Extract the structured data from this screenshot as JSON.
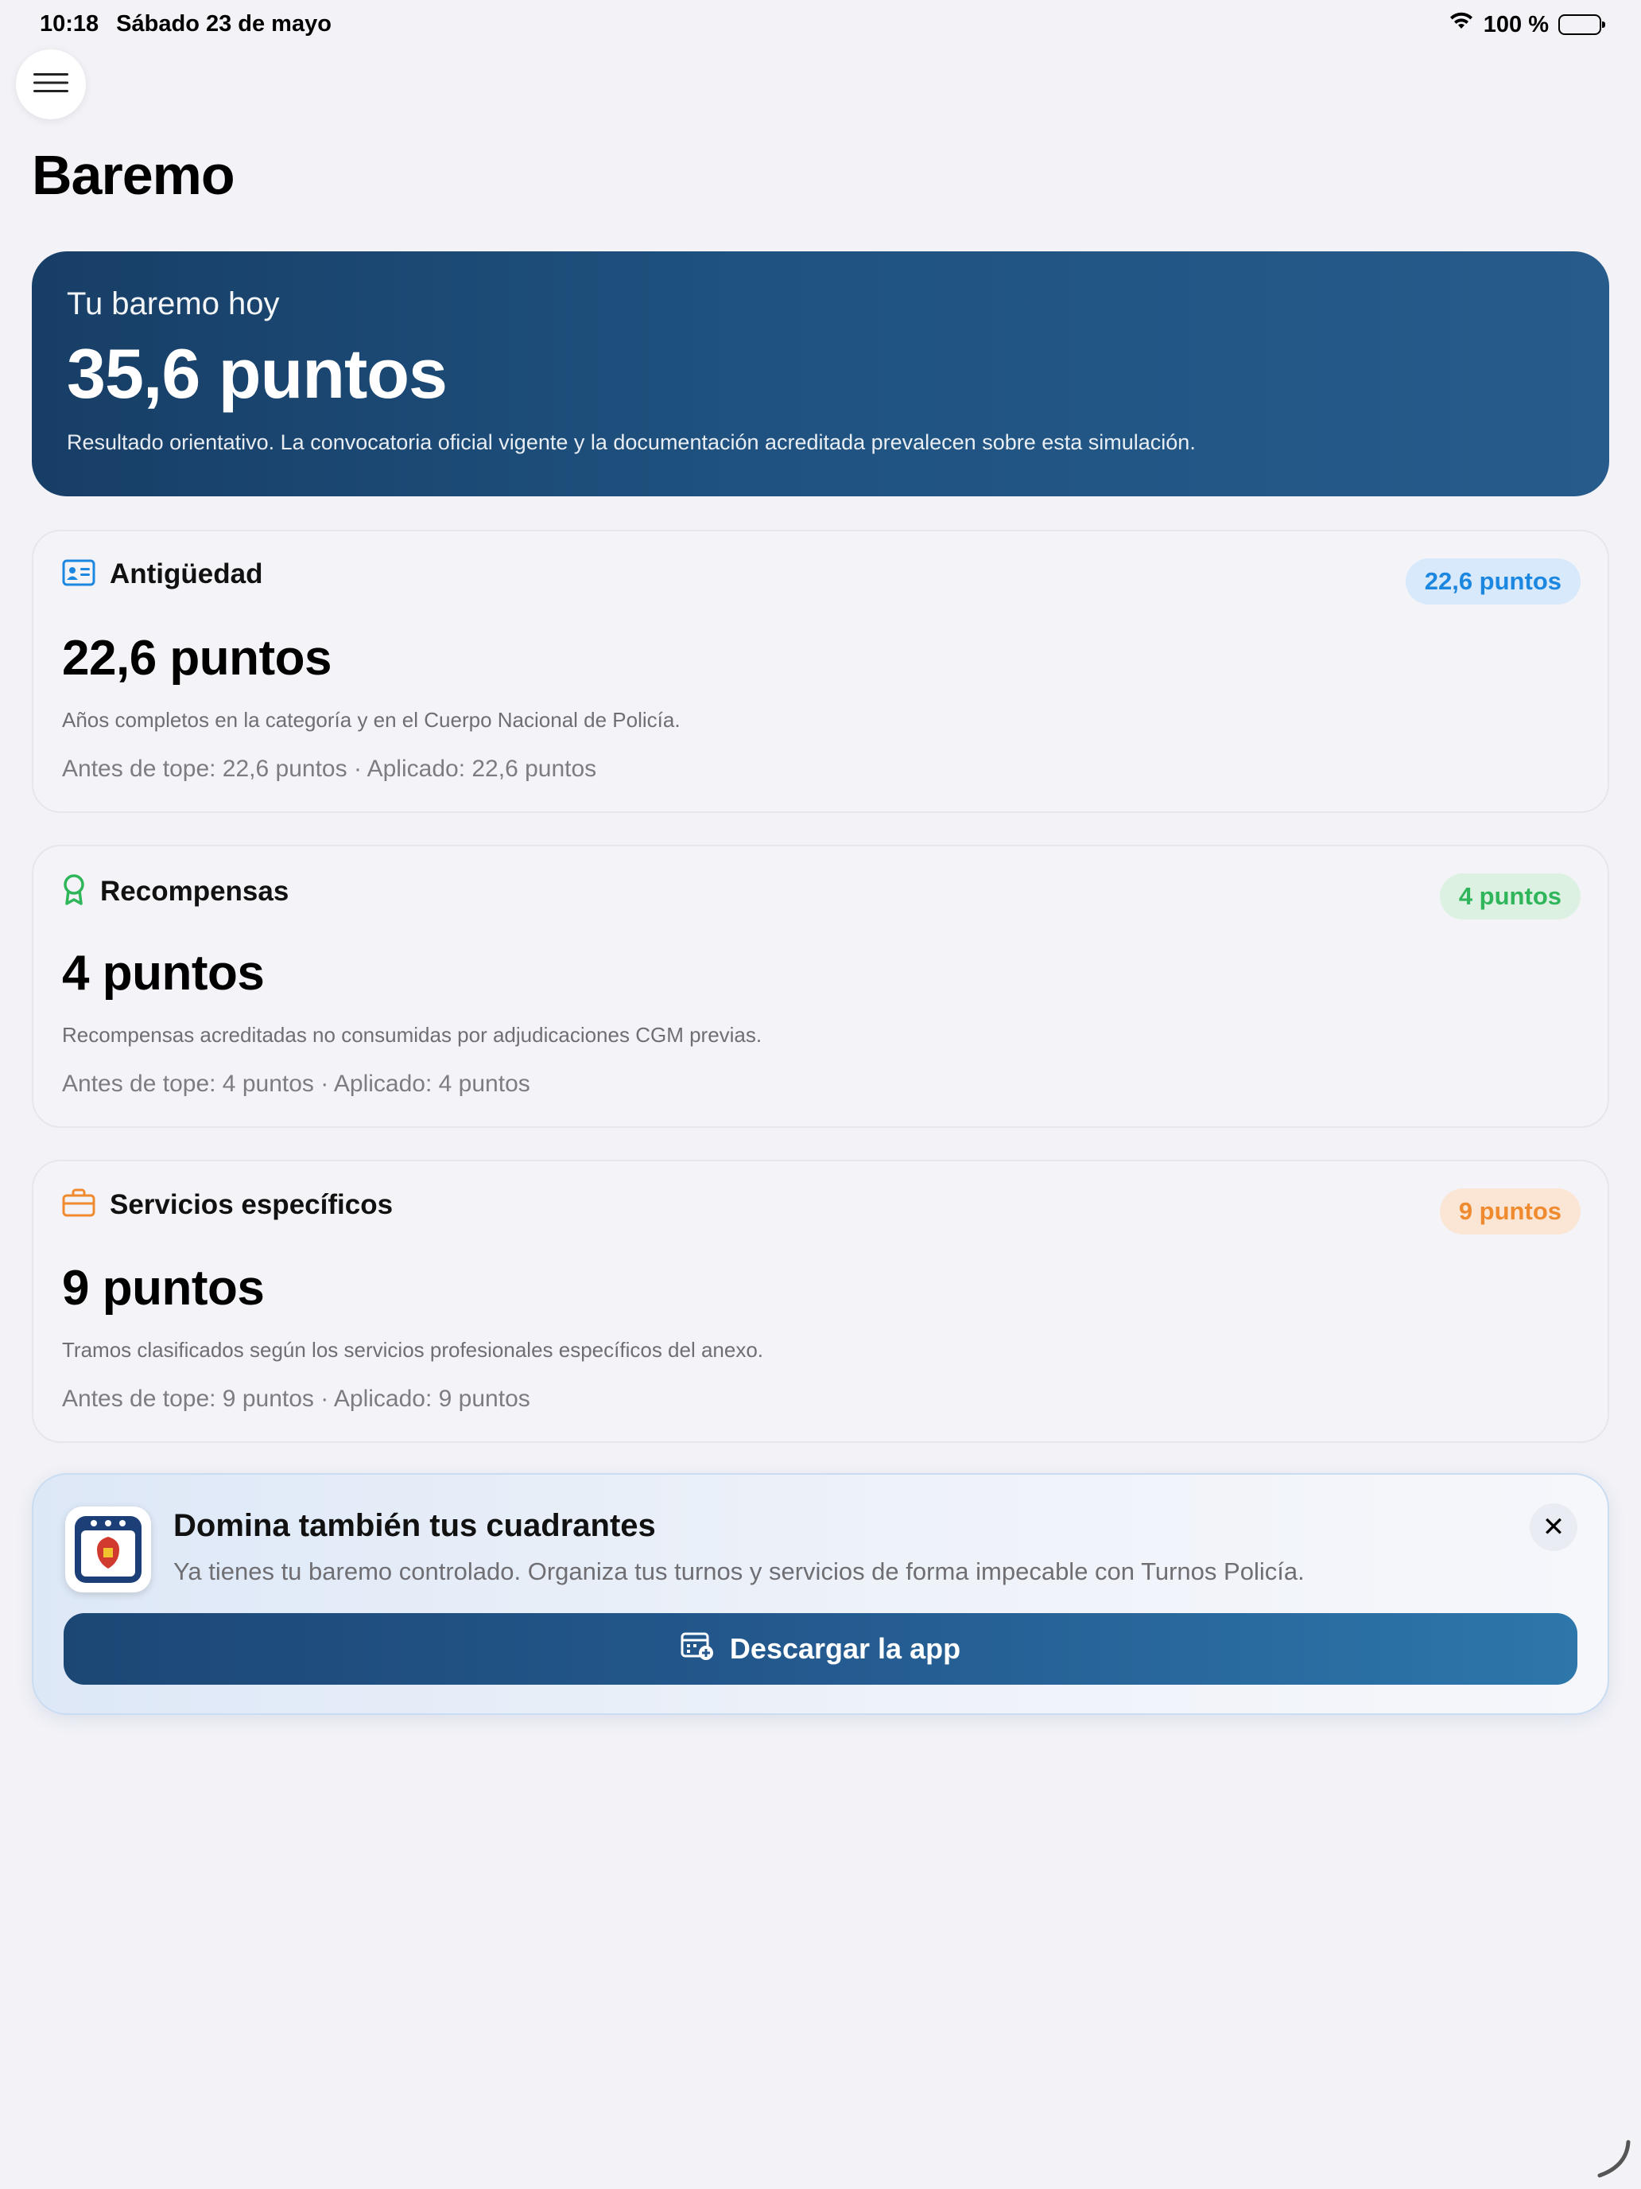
{
  "status_bar": {
    "time": "10:18",
    "date": "Sábado 23 de mayo",
    "battery": "100 %"
  },
  "page": {
    "title": "Baremo"
  },
  "hero": {
    "label": "Tu baremo hoy",
    "value": "35,6 puntos",
    "note": "Resultado orientativo. La convocatoria oficial vigente y la documentación acreditada prevalecen sobre esta simulación."
  },
  "cards": [
    {
      "title": "Antigüedad",
      "icon": "id-card-icon",
      "badge": "22,6 puntos",
      "value": "22,6 puntos",
      "description": "Años completos en la categoría y en el Cuerpo Nacional de Policía.",
      "detail": "Antes de tope: 22,6 puntos · Aplicado: 22,6 puntos",
      "accent": "#1c87e0"
    },
    {
      "title": "Recompensas",
      "icon": "award-ribbon-icon",
      "badge": "4 puntos",
      "value": "4 puntos",
      "description": "Recompensas acreditadas no consumidas por adjudicaciones CGM previas.",
      "detail": "Antes de tope: 4 puntos · Aplicado: 4 puntos",
      "accent": "#2fb55a"
    },
    {
      "title": "Servicios específicos",
      "icon": "briefcase-icon",
      "badge": "9 puntos",
      "value": "9 puntos",
      "description": "Tramos clasificados según los servicios profesionales específicos del anexo.",
      "detail": "Antes de tope: 9 puntos · Aplicado: 9 puntos",
      "accent": "#f08a2e"
    }
  ],
  "promo": {
    "title": "Domina también tus cuadrantes",
    "text": "Ya tienes tu baremo controlado. Organiza tus turnos y servicios de forma impecable con Turnos Policía.",
    "button_label": "Descargar la app",
    "close_symbol": "✕"
  }
}
